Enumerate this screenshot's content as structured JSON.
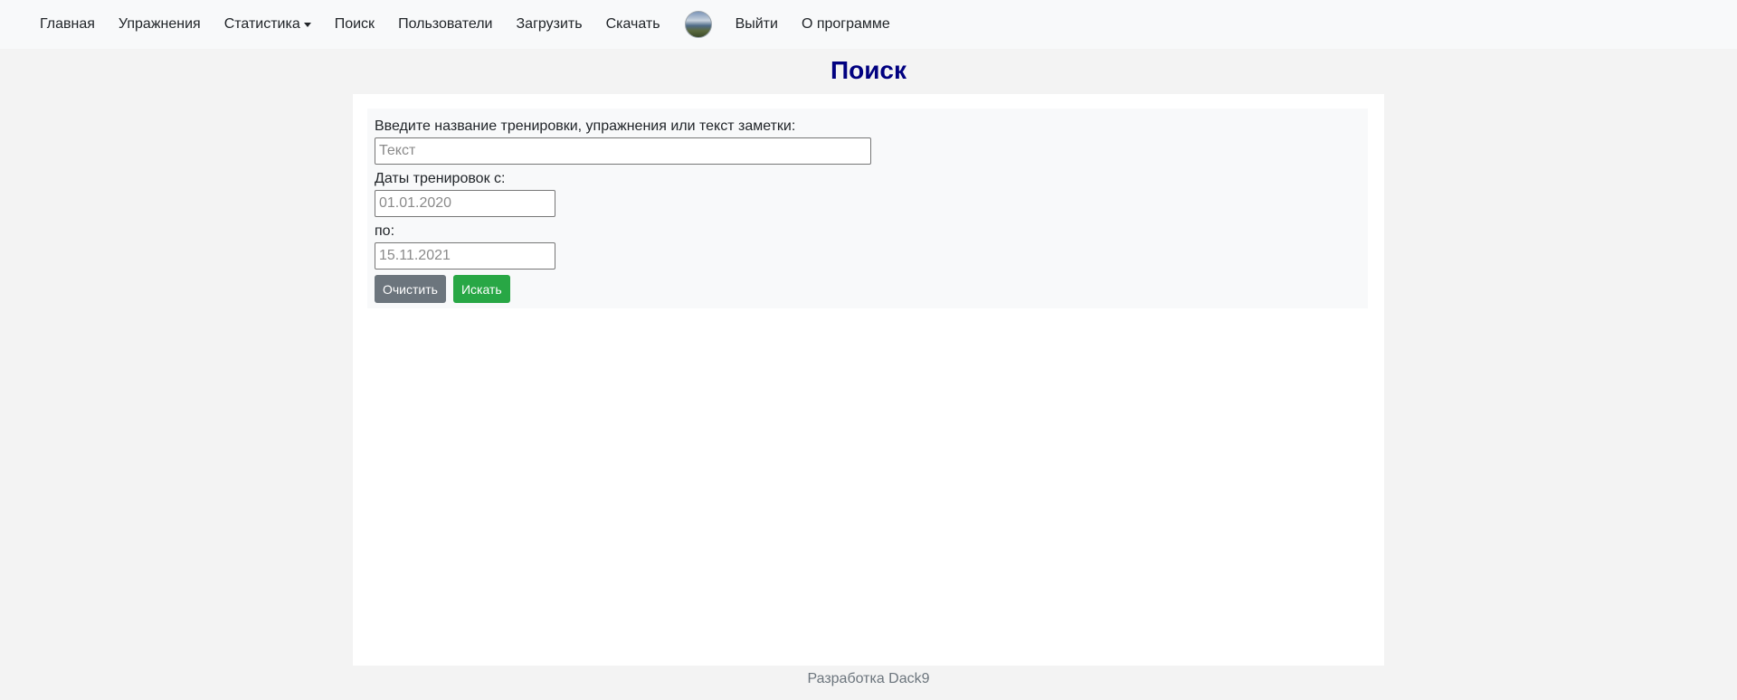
{
  "nav": {
    "home": "Главная",
    "exercises": "Упражнения",
    "statistics": "Статистика",
    "search": "Поиск",
    "users": "Пользователи",
    "upload": "Загрузить",
    "download": "Скачать",
    "logout": "Выйти",
    "about": "О программе"
  },
  "page": {
    "title": "Поиск"
  },
  "form": {
    "query_label": "Введите название тренировки, упражнения или текст заметки:",
    "query_placeholder": "Текст",
    "date_from_label": "Даты тренировок с:",
    "date_from_placeholder": "01.01.2020",
    "date_to_label": "по:",
    "date_to_placeholder": "15.11.2021",
    "clear_label": "Очистить",
    "search_label": "Искать"
  },
  "footer": {
    "text": "Разработка Dack9"
  }
}
